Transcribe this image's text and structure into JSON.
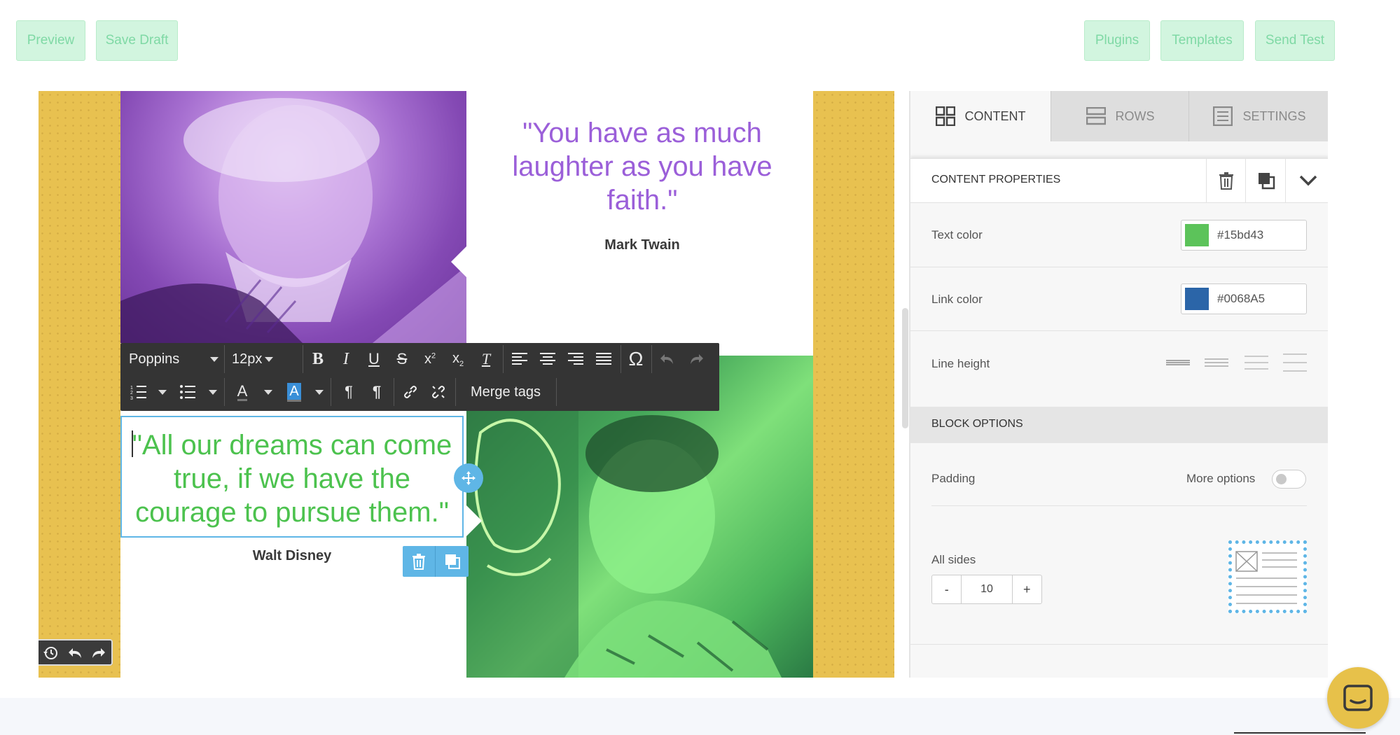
{
  "topbar": {
    "preview": "Preview",
    "save_draft": "Save Draft",
    "plugins": "Plugins",
    "templates": "Templates",
    "send_test": "Send Test"
  },
  "canvas": {
    "quote1": "\"You have as much laughter as you have faith.\"",
    "author1": "Mark Twain",
    "quote2": "\"All our dreams can come true, if we have the courage to pursue them.\"",
    "author2": "Walt Disney"
  },
  "toolbar": {
    "font": "Poppins",
    "size": "12px",
    "merge_tags": "Merge tags"
  },
  "sidebar": {
    "tabs": {
      "content": "CONTENT",
      "rows": "ROWS",
      "settings": "SETTINGS"
    },
    "content_properties": "CONTENT PROPERTIES",
    "text_color_label": "Text color",
    "text_color_value": "#15bd43",
    "link_color_label": "Link color",
    "link_color_value": "#0068A5",
    "line_height_label": "Line height",
    "block_options": "BLOCK OPTIONS",
    "padding_label": "Padding",
    "more_options": "More options",
    "all_sides": "All sides",
    "minus": "-",
    "padding_value": "10",
    "plus": "+"
  },
  "colors": {
    "text_swatch": "#5cc35a",
    "link_swatch": "#2b65a8",
    "accent": "#2f8fd8"
  }
}
